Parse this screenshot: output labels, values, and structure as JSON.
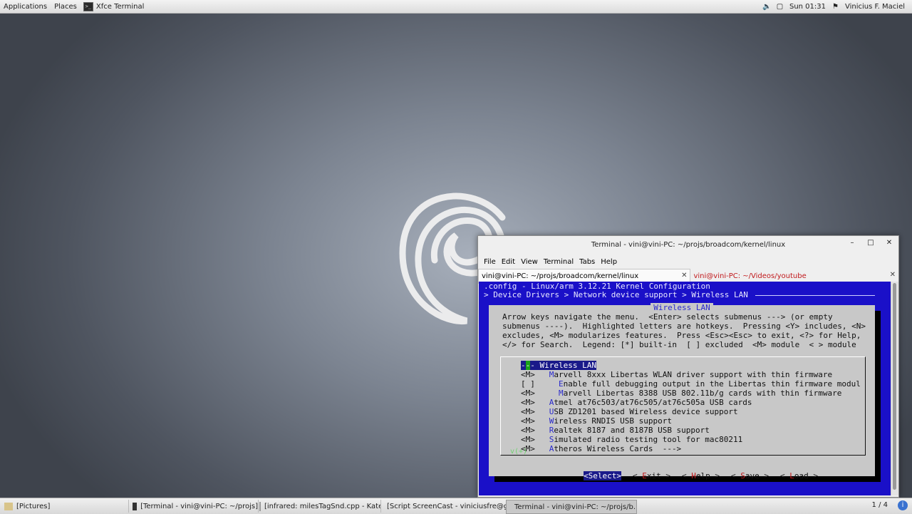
{
  "topbar": {
    "applications": "Applications",
    "places": "Places",
    "active_app": "Xfce Terminal",
    "clock": "Sun 01:31",
    "user": "Vinicius F. Maciel"
  },
  "window": {
    "title": "Terminal - vini@vini-PC: ~/projs/broadcom/kernel/linux",
    "menu": [
      "File",
      "Edit",
      "View",
      "Terminal",
      "Tabs",
      "Help"
    ],
    "tabs": [
      "vini@vini-PC: ~/projs/broadcom/kernel/linux",
      "vini@vini-PC: ~/Videos/youtube"
    ]
  },
  "terminal": {
    "header": ".config - Linux/arm 3.12.21 Kernel Configuration",
    "breadcrumb": "> Device Drivers > Network device support > Wireless LAN",
    "dialog_title": "Wireless LAN",
    "help_lines": [
      "Arrow keys navigate the menu.  <Enter> selects submenus ---> (or empty",
      "submenus ----).  Highlighted letters are hotkeys.  Pressing <Y> includes, <N>",
      "excludes, <M> modularizes features.  Press <Esc><Esc> to exit, <?> for Help,",
      "</> for Search.  Legend: [*] built-in  [ ] excluded  <M> module  < > module"
    ],
    "menu_items": [
      {
        "prefix": "-",
        "hotkey": "-",
        "rest": "- Wireless LAN"
      },
      {
        "prefix": "<M>   ",
        "hotkey": "M",
        "rest": "arvell 8xxx Libertas WLAN driver support with thin firmware"
      },
      {
        "prefix": "[ ]     ",
        "hotkey": "E",
        "rest": "nable full debugging output in the Libertas thin firmware modul"
      },
      {
        "prefix": "<M>     ",
        "hotkey": "M",
        "rest": "arvell Libertas 8388 USB 802.11b/g cards with thin firmware"
      },
      {
        "prefix": "<M>   ",
        "hotkey": "A",
        "rest": "tmel at76c503/at76c505/at76c505a USB cards"
      },
      {
        "prefix": "<M>   ",
        "hotkey": "U",
        "rest": "SB ZD1201 based Wireless device support"
      },
      {
        "prefix": "<M>   ",
        "hotkey": "W",
        "rest": "ireless RNDIS USB support"
      },
      {
        "prefix": "<M>   ",
        "hotkey": "R",
        "rest": "ealtek 8187 and 8187B USB support"
      },
      {
        "prefix": "<M>   ",
        "hotkey": "S",
        "rest": "imulated radio testing tool for mac80211"
      },
      {
        "prefix": "<M>   ",
        "hotkey": "A",
        "rest": "theros Wireless Cards  --->"
      }
    ],
    "more_indicator": "v(+)",
    "buttons": [
      {
        "label": "<Select>",
        "hotkey": "",
        "pre": "",
        "post": ""
      },
      {
        "label": "",
        "pre": "< ",
        "hotkey": "E",
        "post": "xit >"
      },
      {
        "label": "",
        "pre": "< ",
        "hotkey": "H",
        "post": "elp >"
      },
      {
        "label": "",
        "pre": "< ",
        "hotkey": "S",
        "post": "ave >"
      },
      {
        "label": "",
        "pre": "< ",
        "hotkey": "L",
        "post": "oad >"
      }
    ]
  },
  "taskbar": {
    "items": [
      "[Pictures]",
      "[Terminal - vini@vini-PC: ~/projs]",
      "[infrared: milesTagSnd.cpp - Kate]",
      "[Script ScreenCast - viniciusfre@g...",
      "Terminal - vini@vini-PC: ~/projs/b..."
    ],
    "pager": "1 / 4"
  },
  "colors": {
    "terminal_bg": "#1a10c8",
    "dialog_bg": "#c8c8c8",
    "selection": "#1a1a8a",
    "hotkey_blue": "#2a2acc",
    "hotkey_red": "#c0181b"
  }
}
